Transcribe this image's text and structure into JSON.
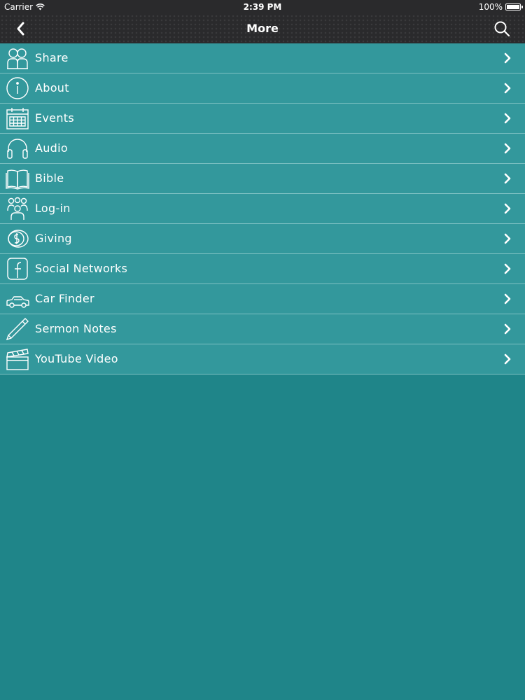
{
  "status_bar": {
    "carrier": "Carrier",
    "time": "2:39 PM",
    "battery": "100%",
    "battery_level": 1.0
  },
  "nav": {
    "title": "More",
    "back_icon": "chevron-left-icon",
    "search_icon": "search-icon"
  },
  "menu": [
    {
      "label": "Share",
      "icon": "share-people-icon"
    },
    {
      "label": "About",
      "icon": "info-icon"
    },
    {
      "label": "Events",
      "icon": "calendar-icon"
    },
    {
      "label": "Audio",
      "icon": "headphones-icon"
    },
    {
      "label": "Bible",
      "icon": "book-icon"
    },
    {
      "label": "Log-in",
      "icon": "users-icon"
    },
    {
      "label": "Giving",
      "icon": "coin-icon"
    },
    {
      "label": "Social Networks",
      "icon": "facebook-icon"
    },
    {
      "label": "Car Finder",
      "icon": "car-icon"
    },
    {
      "label": "Sermon Notes",
      "icon": "pencil-icon"
    },
    {
      "label": "YouTube Video",
      "icon": "clapperboard-icon"
    }
  ],
  "colors": {
    "background": "#1f8589",
    "menu_row": "#33989c",
    "divider": "#7cc0c2",
    "bar": "#2a2a2c"
  }
}
